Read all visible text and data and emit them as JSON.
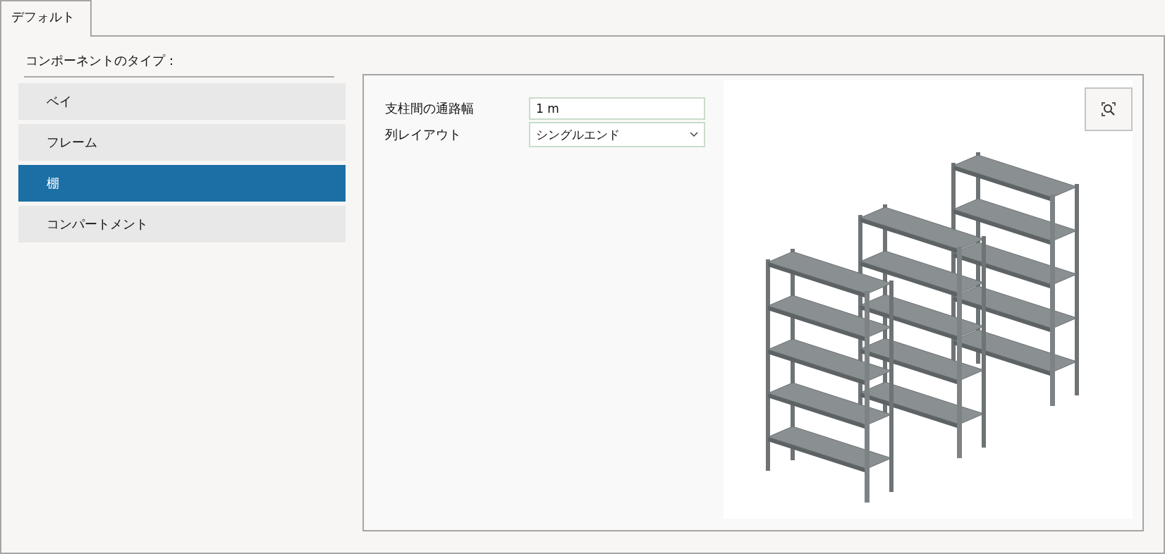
{
  "tabs": [
    {
      "label": "デフォルト",
      "selected": true
    }
  ],
  "component_type": {
    "label": "コンポーネントのタイプ：",
    "items": [
      {
        "label": "ベイ",
        "selected": false
      },
      {
        "label": "フレーム",
        "selected": false
      },
      {
        "label": "棚",
        "selected": true
      },
      {
        "label": "コンパートメント",
        "selected": false
      }
    ]
  },
  "settings": {
    "fields": [
      {
        "label": "支柱間の通路幅",
        "kind": "text",
        "value": "1 m"
      },
      {
        "label": "列レイアウト",
        "kind": "dropdown",
        "value": "シングルエンド"
      }
    ]
  }
}
